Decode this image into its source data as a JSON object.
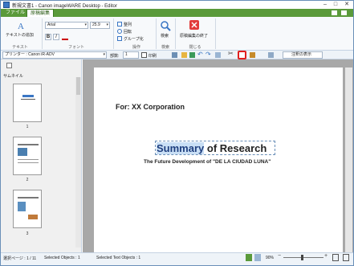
{
  "window": {
    "title": "新規文書1 - Canon imageWARE Desktop - Editor"
  },
  "tabs": [
    {
      "label": "ファイル"
    },
    {
      "label": "原稿編集"
    }
  ],
  "ribbon": {
    "text_group": {
      "button_label": "テキストの追加",
      "group_label": "テキスト"
    },
    "font_group": {
      "font_name": "Arial",
      "font_size": "25.9",
      "bold": "B",
      "italic": "I",
      "group_label": "フォント"
    },
    "operation_group": {
      "arrange": "整列",
      "rotate": "回転",
      "group": "グループ化",
      "group_label": "操作"
    },
    "search_group": {
      "search": "検索",
      "group_label": "検索"
    },
    "close_group": {
      "close": "原稿編集の終了",
      "group_label": "閉じる"
    }
  },
  "toolbar2": {
    "printer_label": "プリンター : Canon iR-ADV",
    "copies_label": "部数:",
    "copies_value": "1",
    "print_label": "印刷",
    "annotation_label": "注釈の表示"
  },
  "sidebar": {
    "title": "サムネイル",
    "thumbnails": [
      {
        "number": "1"
      },
      {
        "number": "2"
      },
      {
        "number": "3"
      }
    ]
  },
  "document": {
    "for_line": "For: XX Corporation",
    "heading_part1": "Summary",
    "heading_part2": "of Research",
    "subtitle": "The Future Development of \"DE LA CIUDAD LUNA\""
  },
  "status": {
    "page": "選択ページ : 1 / 11",
    "selected_objects": "Selected Objects : 1",
    "selected_text_objects": "Selected Text Objects : 1",
    "zoom": "90%"
  },
  "colors": {
    "tab_green": "#5a9a3a",
    "selection_highlight": "#c9dff5",
    "close_red": "#e23b3b"
  }
}
